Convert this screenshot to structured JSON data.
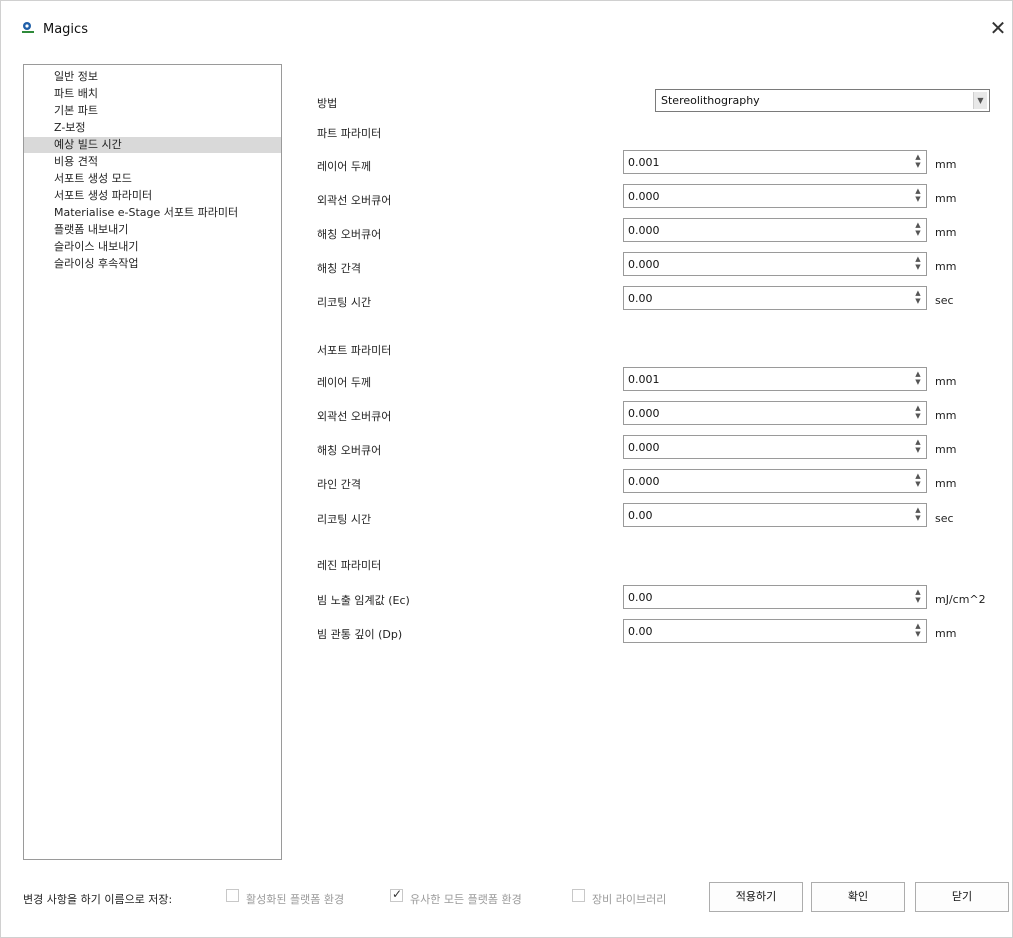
{
  "window": {
    "title": "Magics",
    "close_glyph": "✕",
    "icon": "magics-logo-icon",
    "accent": "#1f5fa8"
  },
  "nav": {
    "items": [
      {
        "label": "일반 정보"
      },
      {
        "label": "파트 배치"
      },
      {
        "label": "기본 파트"
      },
      {
        "label": "Z-보정"
      },
      {
        "label": "예상 빌드 시간",
        "selected": true
      },
      {
        "label": "비용 견적"
      },
      {
        "label": "서포트 생성 모드"
      },
      {
        "label": "서포트 생성 파라미터"
      },
      {
        "label": "Materialise e-Stage 서포트 파라미터"
      },
      {
        "label": "플랫폼 내보내기"
      },
      {
        "label": "슬라이스 내보내기"
      },
      {
        "label": "슬라이싱 후속작업"
      }
    ]
  },
  "method": {
    "label": "방법",
    "value": "Stereolithography"
  },
  "part_params": {
    "title": "파트 파라미터",
    "rows": [
      {
        "label": "레이어 두께",
        "value": "0.001",
        "unit": "mm"
      },
      {
        "label": "외곽선 오버큐어",
        "value": "0.000",
        "unit": "mm"
      },
      {
        "label": "해칭 오버큐어",
        "value": "0.000",
        "unit": "mm"
      },
      {
        "label": "해칭 간격",
        "value": "0.000",
        "unit": "mm"
      },
      {
        "label": "리코팅 시간",
        "value": "0.00",
        "unit": "sec"
      }
    ]
  },
  "support_params": {
    "title": "서포트 파라미터",
    "rows": [
      {
        "label": "레이어 두께",
        "value": "0.001",
        "unit": "mm"
      },
      {
        "label": "외곽선 오버큐어",
        "value": "0.000",
        "unit": "mm"
      },
      {
        "label": "해칭 오버큐어",
        "value": "0.000",
        "unit": "mm"
      },
      {
        "label": "라인 간격",
        "value": "0.000",
        "unit": "mm"
      },
      {
        "label": "리코팅 시간",
        "value": "0.00",
        "unit": "sec"
      }
    ]
  },
  "resin_params": {
    "title": "레진 파라미터",
    "rows": [
      {
        "label": "빔 노출 임계값 (Ec)",
        "value": "0.00",
        "unit": "mJ/cm^2"
      },
      {
        "label": "빔 관통 깊이 (Dp)",
        "value": "0.00",
        "unit": "mm"
      }
    ]
  },
  "footer": {
    "save_label": "변경 사항을 하기 이름으로 저장:",
    "options": [
      {
        "label": "활성화된 플랫폼 환경",
        "checked": false
      },
      {
        "label": "유사한 모든 플랫폼 환경",
        "checked": true
      },
      {
        "label": "장비 라이브러리",
        "checked": false
      }
    ],
    "buttons": {
      "apply": "적용하기",
      "ok": "확인",
      "close": "닫기"
    }
  }
}
